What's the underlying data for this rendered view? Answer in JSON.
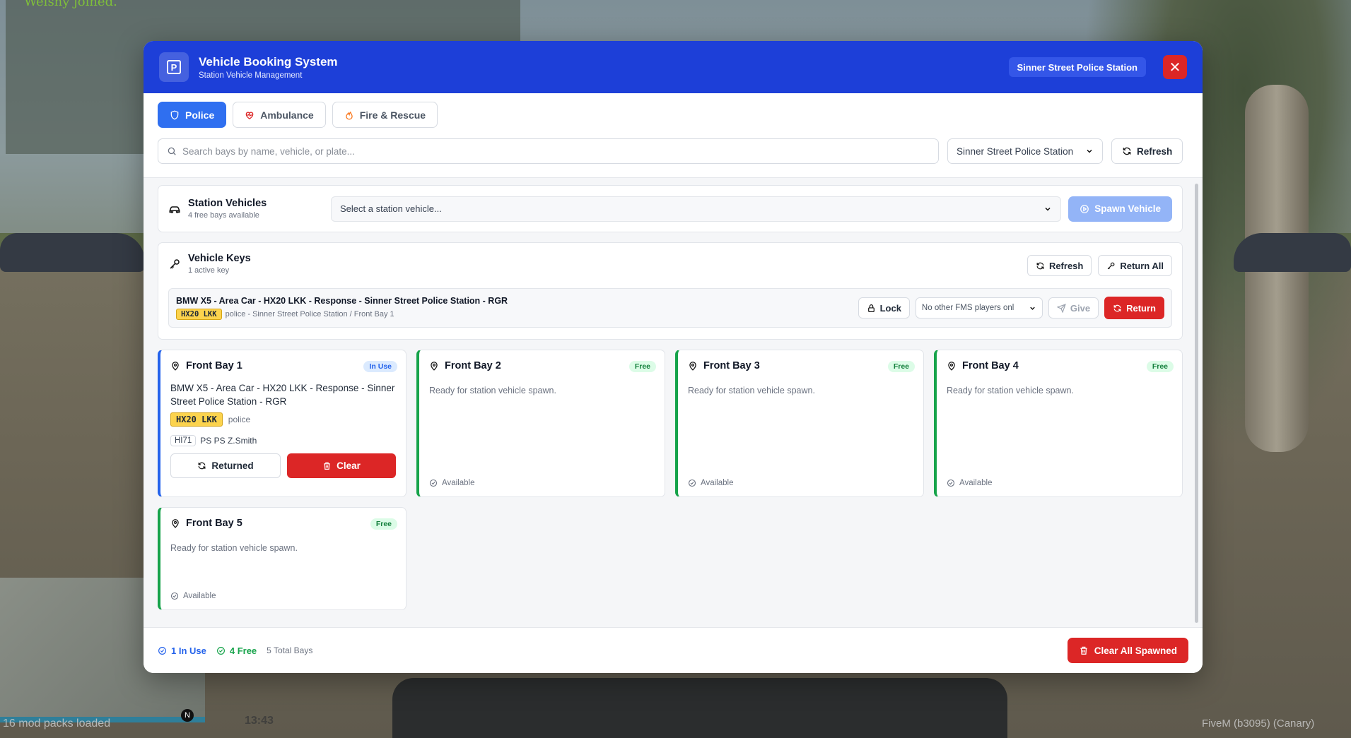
{
  "background": {
    "chat_line": "Welshy joined.",
    "hud_mods": "16 mod packs loaded",
    "hud_time": "13:43",
    "hud_build": "FiveM (b3095) (Canary)",
    "compass": "N"
  },
  "header": {
    "title": "Vehicle Booking System",
    "subtitle": "Station Vehicle Management",
    "station_badge": "Sinner Street Police Station",
    "logo_letter": "P",
    "close_glyph": "✕"
  },
  "tabs": [
    {
      "label": "Police",
      "icon": "shield-icon",
      "active": true
    },
    {
      "label": "Ambulance",
      "icon": "heart-pulse-icon",
      "active": false
    },
    {
      "label": "Fire & Rescue",
      "icon": "flame-icon",
      "active": false
    }
  ],
  "search": {
    "placeholder": "Search bays by name, vehicle, or plate...",
    "station_select": "Sinner Street Police Station",
    "refresh_label": "Refresh"
  },
  "station_vehicles": {
    "title": "Station Vehicles",
    "subtitle": "4 free bays available",
    "select_placeholder": "Select a station vehicle...",
    "spawn_label": "Spawn Vehicle"
  },
  "vehicle_keys": {
    "title": "Vehicle Keys",
    "subtitle": "1 active key",
    "refresh_label": "Refresh",
    "return_all_label": "Return All",
    "key": {
      "name": "BMW X5 - Area Car - HX20 LKK - Response - Sinner Street Police Station - RGR",
      "plate": "HX20 LKK",
      "meta": "police - Sinner Street Police Station / Front Bay 1",
      "lock_label": "Lock",
      "give_select": "No other FMS players onl",
      "give_label": "Give",
      "return_label": "Return"
    }
  },
  "bays": [
    {
      "name": "Front Bay 1",
      "status": "In Use",
      "vehicle": "BMW X5 - Area Car - HX20 LKK - Response - Sinner Street Police Station - RGR",
      "plate": "HX20 LKK",
      "service": "police",
      "callsign": "HI71",
      "crew": "PS PS Z.Smith",
      "returned_label": "Returned",
      "clear_label": "Clear"
    },
    {
      "name": "Front Bay 2",
      "status": "Free",
      "desc": "Ready for station vehicle spawn.",
      "availability": "Available"
    },
    {
      "name": "Front Bay 3",
      "status": "Free",
      "desc": "Ready for station vehicle spawn.",
      "availability": "Available"
    },
    {
      "name": "Front Bay 4",
      "status": "Free",
      "desc": "Ready for station vehicle spawn.",
      "availability": "Available"
    },
    {
      "name": "Front Bay 5",
      "status": "Free",
      "desc": "Ready for station vehicle spawn.",
      "availability": "Available"
    }
  ],
  "footer": {
    "in_use": "1 In Use",
    "free": "4 Free",
    "total": "5 Total Bays",
    "clear_all_label": "Clear All Spawned"
  },
  "colors": {
    "header_blue": "#1d3fd8",
    "accent_blue": "#2f6ff0",
    "danger_red": "#dc2626",
    "free_green": "#16a34a",
    "plate_yellow": "#fcd34d"
  }
}
